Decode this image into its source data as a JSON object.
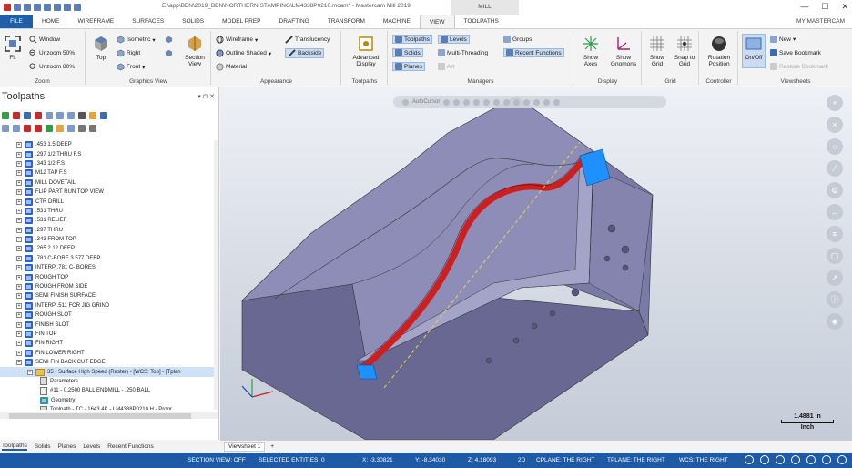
{
  "titlebar": {
    "title": "E:\\app\\BEN\\2019_BEN\\NORTHERN STAMPING\\LM4338P0210.mcam* - Mastercam Mill 2019",
    "context_tab": "MILL",
    "minimize": "—",
    "maximize": "☐",
    "close": "✕"
  },
  "tabs": [
    "FILE",
    "HOME",
    "WIREFRAME",
    "SURFACES",
    "SOLIDS",
    "MODEL PREP",
    "DRAFTING",
    "TRANSFORM",
    "MACHINE",
    "VIEW",
    "TOOLPATHS"
  ],
  "active_tab": "VIEW",
  "my_mastercam": "MY MASTERCAM",
  "ribbon": {
    "zoom": {
      "label": "Zoom",
      "fit": "Fit",
      "window": "Window",
      "unzoom50": "Unzoom 50%",
      "unzoom80": "Unzoom 80%"
    },
    "graphics_view": {
      "label": "Graphics View",
      "top": "Top",
      "isometric": "Isometric",
      "right": "Right",
      "front": "Front",
      "section_view": "Section View"
    },
    "appearance": {
      "label": "Appearance",
      "wireframe": "Wireframe",
      "outline_shaded": "Outline Shaded",
      "material": "Material",
      "translucency": "Translucency",
      "backside": "Backside"
    },
    "toolpaths": {
      "label": "Toolpaths",
      "advanced_display": "Advanced Display"
    },
    "managers": {
      "label": "Managers",
      "toolpaths": "Toolpaths",
      "levels": "Levels",
      "groups": "Groups",
      "solids": "Solids",
      "multithreading": "Multi-Threading",
      "recent_functions": "Recent Functions",
      "planes": "Planes",
      "art": "Art"
    },
    "display": {
      "label": "Display",
      "show_axes": "Show Axes",
      "show_gnomons": "Show Gnomons"
    },
    "grid": {
      "label": "Grid",
      "show_grid": "Show Grid",
      "snap_to_grid": "Snap to Grid"
    },
    "controller": {
      "label": "Controller",
      "rotation_position": "Rotation Position"
    },
    "viewsheets": {
      "label": "Viewsheets",
      "onoff": "On/Off",
      "new": "New",
      "save_bookmark": "Save Bookmark",
      "restore_bookmark": "Restore Bookmark"
    }
  },
  "toolpaths_panel": {
    "title": "Toolpaths",
    "pin": "▾ ⊓ ✕",
    "items": [
      ".453 1.5 DEEP",
      ".297 1/2 THRU F.S",
      ".343 1/2 F.S",
      "M12 TAP F.S",
      "MILL DOVETAIL",
      "FLIP PART RUN TOP VIEW",
      "CTR DRILL",
      ".531 THRU",
      ".531 RELIEF",
      ".297 THRU",
      ".343 FROM TOP",
      ".265 2.12 DEEP",
      ".781 C-BORE 3.577 DEEP",
      "INTERP .781 C- BORES",
      "ROUGH TOP",
      "ROUGH FROM SIDE",
      "SEMI FINISH SURFACE",
      "INTERP .511 FOR JIG GRIND",
      "ROUGH SLOT",
      "FINISH SLOT",
      "FIN TOP",
      "FIN RIGHT",
      "FIN LOWER RIGHT",
      "SEMI FIN BACK CUT EDGE"
    ],
    "op35": "35 - Surface High Speed (Raster) - [WCS: Top] - [Tplan",
    "parameters": "Parameters",
    "tool": "#11 - 0.2500 BALL ENDMILL - .250 BALL",
    "geometry": "Geometry",
    "toolpath_row": "Toolpath - TC - 1643.4K - LM4338P0210 H - Progr"
  },
  "panel_tabs": [
    "Toolpaths",
    "Solids",
    "Planes",
    "Levels",
    "Recent Functions"
  ],
  "viewport": {
    "autocursor": "AutoCursor",
    "scale_value": "1.4881 in",
    "scale_unit": "Inch"
  },
  "viewsheet_tab": "Viewsheet 1",
  "viewsheet_add": "+",
  "status": {
    "section_view": "SECTION VIEW: OFF",
    "selected": "SELECTED ENTITIES: 0",
    "x": "X:  -3.30821",
    "y": "Y:  -8.34030",
    "z": "Z:  4.18093",
    "mode": "2D",
    "cplane": "CPLANE: THE RIGHT",
    "tplane": "TPLANE: THE RIGHT",
    "wcs": "WCS: THE RIGHT"
  },
  "colors": {
    "file_tab": "#1f5fa8",
    "statusbar": "#1e5aa6",
    "part": "#7c7ca6",
    "toolpath": "#cc1f1f",
    "stock_marker": "#1e90ff"
  }
}
